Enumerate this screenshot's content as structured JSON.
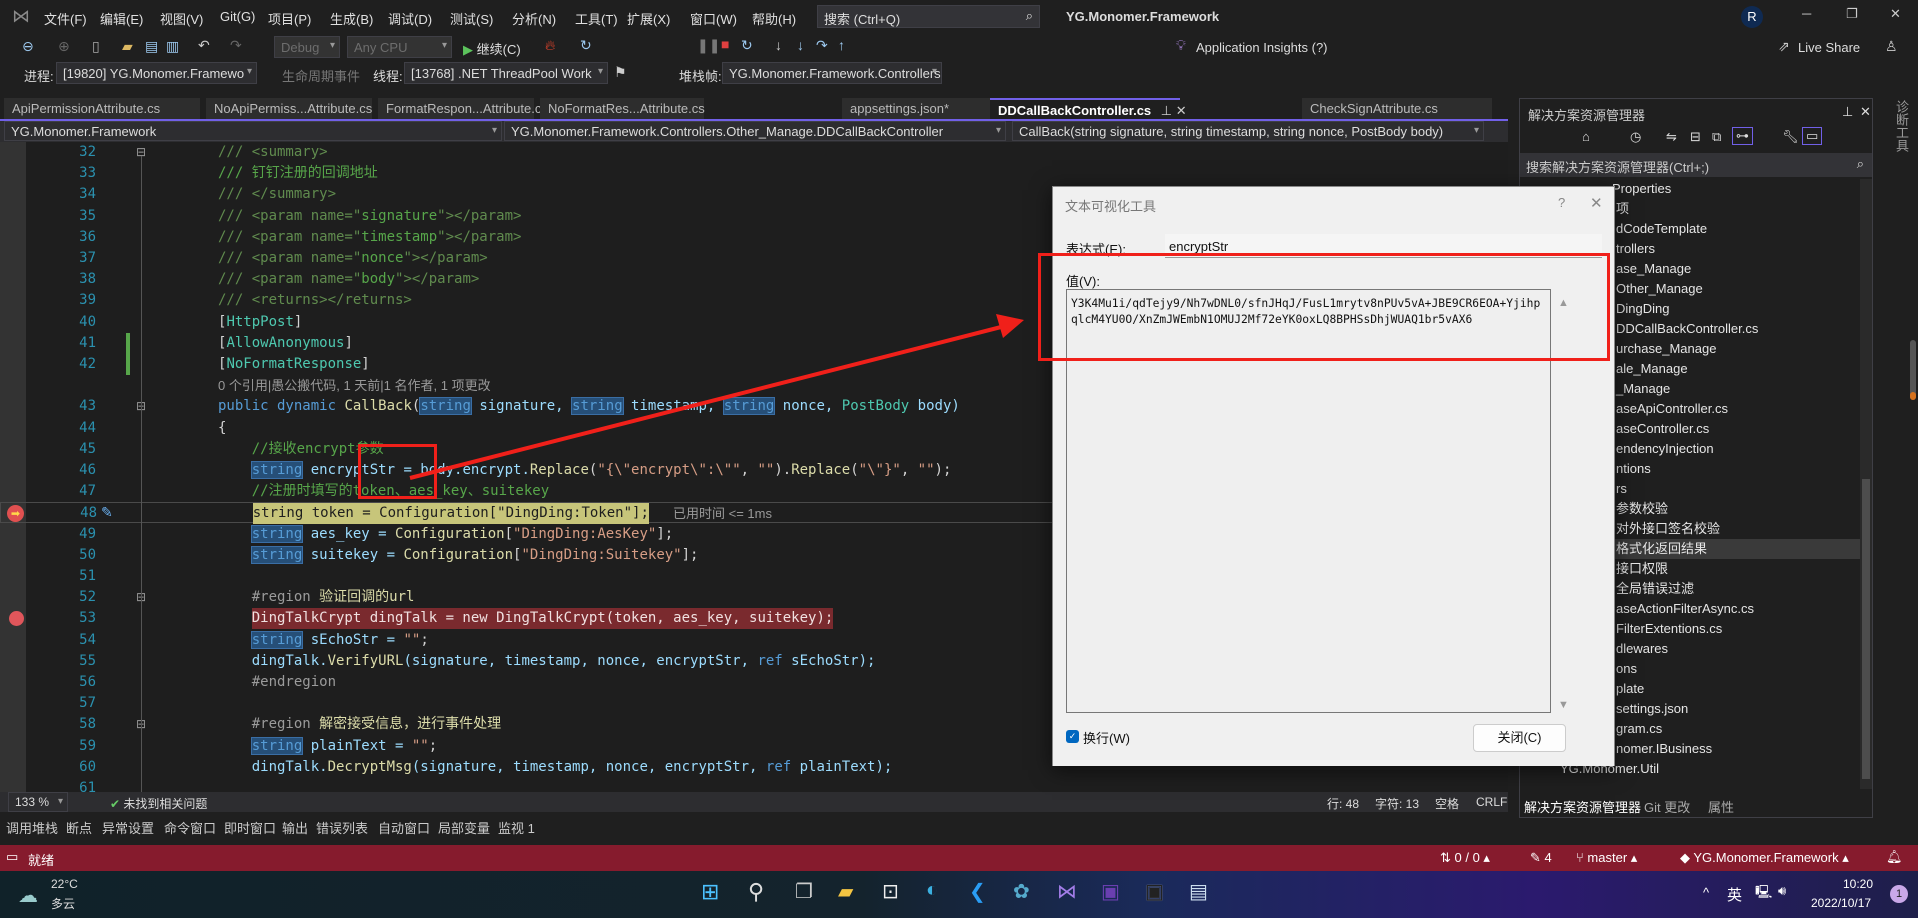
{
  "window": {
    "title": "YG.Monomer.Framework",
    "avatar": "R",
    "menu": [
      "文件(F)",
      "编辑(E)",
      "视图(V)",
      "Git(G)",
      "项目(P)",
      "生成(B)",
      "调试(D)",
      "测试(S)",
      "分析(N)",
      "工具(T)",
      "扩展(X)",
      "窗口(W)",
      "帮助(H)"
    ],
    "search_placeholder": "搜索 (Ctrl+Q)"
  },
  "toolbar": {
    "config": "Debug",
    "platform": "Any CPU",
    "continue": "继续(C)",
    "app_insights": "Application Insights (?)",
    "live_share": "Live Share"
  },
  "debug_location": {
    "process_label": "进程:",
    "process": "[19820] YG.Monomer.Framewo",
    "lifecycle": "生命周期事件",
    "thread_label": "线程:",
    "thread": "[13768] .NET ThreadPool Work",
    "stack_label": "堆栈帧:",
    "stack": "YG.Monomer.Framework.Controllers.C"
  },
  "tabs": [
    {
      "label": "ApiPermissionAttribute.cs"
    },
    {
      "label": "NoApiPermiss...Attribute.cs"
    },
    {
      "label": "FormatRespon...Attribute.cs"
    },
    {
      "label": "NoFormatRes...Attribute.cs"
    },
    {
      "label": "appsettings.json*"
    },
    {
      "label": "DDCallBackController.cs",
      "active": true
    },
    {
      "label": "CheckSignAttribute.cs"
    }
  ],
  "navbar": {
    "project": "YG.Monomer.Framework",
    "class": "YG.Monomer.Framework.Controllers.Other_Manage.DDCallBackController",
    "member": "CallBack(string signature, string timestamp, string nonce, PostBody body)"
  },
  "code": {
    "codelens": "0 个引用|愚公搬代码, 1 天前|1 名作者, 1 项更改",
    "elapsed": "已用时间 <= 1ms",
    "current_line": 48,
    "breakpoint_line": 53,
    "lines": [
      {
        "n": "32",
        "i": 0,
        "tk": [
          [
            "/// <summary>",
            "d"
          ]
        ]
      },
      {
        "n": "33",
        "i": 0,
        "tk": [
          [
            "/// 钉钉注册的回调地址",
            "c"
          ]
        ]
      },
      {
        "n": "34",
        "i": 0,
        "tk": [
          [
            "/// </summary>",
            "d"
          ]
        ]
      },
      {
        "n": "35",
        "i": 0,
        "tk": [
          [
            "/// <param name=\"",
            "d"
          ],
          [
            "signature",
            "c"
          ],
          [
            "\"></param>",
            "d"
          ]
        ]
      },
      {
        "n": "36",
        "i": 0,
        "tk": [
          [
            "/// <param name=\"",
            "d"
          ],
          [
            "timestamp",
            "c"
          ],
          [
            "\"></param>",
            "d"
          ]
        ]
      },
      {
        "n": "37",
        "i": 0,
        "tk": [
          [
            "/// <param name=\"",
            "d"
          ],
          [
            "nonce",
            "c"
          ],
          [
            "\"></param>",
            "d"
          ]
        ]
      },
      {
        "n": "38",
        "i": 0,
        "tk": [
          [
            "/// <param name=\"",
            "d"
          ],
          [
            "body",
            "c"
          ],
          [
            "\"></param>",
            "d"
          ]
        ]
      },
      {
        "n": "39",
        "i": 0,
        "tk": [
          [
            "/// <returns></returns>",
            "d"
          ]
        ]
      },
      {
        "n": "40",
        "i": 0,
        "tk": [
          [
            "[",
            "p"
          ],
          [
            "HttpPost",
            "t"
          ],
          [
            "]",
            "p"
          ]
        ]
      },
      {
        "n": "41",
        "i": 0,
        "tk": [
          [
            "[",
            "p"
          ],
          [
            "AllowAnonymous",
            "t"
          ],
          [
            "]",
            "p"
          ]
        ]
      },
      {
        "n": "42",
        "i": 0,
        "tk": [
          [
            "[",
            "p"
          ],
          [
            "NoFormatResponse",
            "t"
          ],
          [
            "]",
            "p"
          ]
        ]
      },
      {
        "n": "",
        "i": 0,
        "lens": true,
        "tk": []
      },
      {
        "n": "43",
        "i": 0,
        "tk": [
          [
            "public dynamic ",
            "k"
          ],
          [
            "CallBack",
            "m"
          ],
          [
            "(",
            "p"
          ],
          [
            "string",
            "k hl"
          ],
          [
            " signature, ",
            "v"
          ],
          [
            "string",
            "k hl"
          ],
          [
            " timestamp, ",
            "v"
          ],
          [
            "string",
            "k hl"
          ],
          [
            " nonce, ",
            "v"
          ],
          [
            "PostBody",
            "t"
          ],
          [
            " body)",
            "v"
          ]
        ]
      },
      {
        "n": "44",
        "i": 0,
        "tk": [
          [
            "{",
            "p"
          ]
        ]
      },
      {
        "n": "45",
        "i": 4,
        "tk": [
          [
            "//接收encrypt参数",
            "c"
          ]
        ]
      },
      {
        "n": "46",
        "i": 4,
        "tk": [
          [
            "string",
            "k hl"
          ],
          [
            " encryptStr = body.encrypt.",
            "v"
          ],
          [
            "Replace",
            "m"
          ],
          [
            "(",
            "p"
          ],
          [
            "\"{\\\"encrypt\\\":\\\"\"",
            "s"
          ],
          [
            ", ",
            "p"
          ],
          [
            "\"\"",
            "s"
          ],
          [
            ").",
            "p"
          ],
          [
            "Replace",
            "m"
          ],
          [
            "(",
            "p"
          ],
          [
            "\"\\\"}\"",
            "s"
          ],
          [
            ", ",
            "p"
          ],
          [
            "\"\"",
            "s"
          ],
          [
            ");",
            "p"
          ]
        ]
      },
      {
        "n": "47",
        "i": 4,
        "tk": [
          [
            "//注册时填写的token、aes_key、suitekey",
            "c"
          ]
        ]
      },
      {
        "n": "48",
        "i": 4,
        "tk": [
          [
            "string token = Configuration[\"DingDing:Token\"];",
            "p"
          ]
        ]
      },
      {
        "n": "49",
        "i": 4,
        "tk": [
          [
            "string",
            "k hl"
          ],
          [
            " aes_key = ",
            "v"
          ],
          [
            "Configuration",
            "m"
          ],
          [
            "[",
            "p"
          ],
          [
            "\"DingDing:AesKey\"",
            "s"
          ],
          [
            "];",
            "p"
          ]
        ]
      },
      {
        "n": "50",
        "i": 4,
        "tk": [
          [
            "string",
            "k hl"
          ],
          [
            " suitekey = ",
            "v"
          ],
          [
            "Configuration",
            "m"
          ],
          [
            "[",
            "p"
          ],
          [
            "\"DingDing:Suitekey\"",
            "s"
          ],
          [
            "];",
            "p"
          ]
        ]
      },
      {
        "n": "51",
        "i": 4,
        "tk": []
      },
      {
        "n": "52",
        "i": 4,
        "tk": [
          [
            "#region ",
            "r"
          ],
          [
            "验证回调的url",
            "m"
          ]
        ]
      },
      {
        "n": "53",
        "i": 4,
        "tk": [
          [
            "DingTalkCrypt dingTalk = new DingTalkCrypt(token, aes_key, suitekey);",
            "p"
          ]
        ]
      },
      {
        "n": "54",
        "i": 4,
        "tk": [
          [
            "string",
            "k hl"
          ],
          [
            " sEchoStr = ",
            "v"
          ],
          [
            "\"\"",
            "s"
          ],
          [
            ";",
            "p"
          ]
        ]
      },
      {
        "n": "55",
        "i": 4,
        "tk": [
          [
            "dingTalk.",
            "v"
          ],
          [
            "VerifyURL",
            "m"
          ],
          [
            "(signature, timestamp, nonce, encryptStr, ",
            "v"
          ],
          [
            "ref",
            "k"
          ],
          [
            " sEchoStr);",
            "v"
          ]
        ]
      },
      {
        "n": "56",
        "i": 4,
        "tk": [
          [
            "#endregion",
            "r"
          ]
        ]
      },
      {
        "n": "57",
        "i": 4,
        "tk": []
      },
      {
        "n": "58",
        "i": 4,
        "tk": [
          [
            "#region ",
            "r"
          ],
          [
            "解密接受信息，进行事件处理",
            "m"
          ]
        ]
      },
      {
        "n": "59",
        "i": 4,
        "tk": [
          [
            "string",
            "k hl"
          ],
          [
            " plainText = ",
            "v"
          ],
          [
            "\"\"",
            "s"
          ],
          [
            ";",
            "p"
          ]
        ]
      },
      {
        "n": "60",
        "i": 4,
        "tk": [
          [
            "dingTalk.",
            "v"
          ],
          [
            "DecryptMsg",
            "m"
          ],
          [
            "(signature, timestamp, nonce, encryptStr, ",
            "v"
          ],
          [
            "ref",
            "k"
          ],
          [
            " plainText);",
            "v"
          ]
        ]
      },
      {
        "n": "61",
        "i": 4,
        "tk": []
      }
    ]
  },
  "editor_status": {
    "zoom": "133 %",
    "issues": "未找到相关问题",
    "line": "行: 48",
    "char": "字符: 13",
    "whitespace": "空格",
    "eol": "CRLF"
  },
  "tool_tabs": [
    "调用堆栈",
    "断点",
    "异常设置",
    "命令窗口",
    "即时窗口",
    "输出",
    "错误列表",
    "自动窗口",
    "局部变量",
    "监视 1"
  ],
  "solution_explorer": {
    "title": "解决方案资源管理器",
    "search_placeholder": "搜索解决方案资源管理器(Ctrl+;)",
    "items": [
      "Properties",
      "项",
      "dCodeTemplate",
      "trollers",
      "ase_Manage",
      "Other_Manage",
      "DingDing",
      "DDCallBackController.cs",
      "urchase_Manage",
      "ale_Manage",
      "_Manage",
      "aseApiController.cs",
      "aseController.cs",
      "endencyInjection",
      "ntions",
      "rs",
      "参数校验",
      "对外接口签名校验",
      "格式化返回结果",
      "接口权限",
      "全局错误过滤",
      "aseActionFilterAsync.cs",
      "FilterExtentions.cs",
      "dlewares",
      "ons",
      "plate",
      "settings.json",
      "gram.cs",
      "nomer.IBusiness",
      "YG.Monomer.Util"
    ],
    "selected_index": 18,
    "bottom_tabs": [
      "解决方案资源管理器",
      "Git 更改",
      "属性"
    ],
    "side_label": "诊断工具"
  },
  "dialog": {
    "title": "文本可视化工具",
    "expression_label": "表达式(E):",
    "expression": "encryptStr",
    "value_label": "值(V):",
    "value": "Y3K4Mu1i/qdTejy9/Nh7wDNL0/sfnJHqJ/FusL1mrytv8nPUv5vA+JBE9CR6EOA+YjihpqlcM4YU0O/XnZmJWEmbN1OMUJ2Mf72eYK0oxLQ8BPHSsDhjWUAQ1br5vAX6",
    "wrap_label": "换行(W)",
    "wrap_checked": true,
    "close_button": "关闭(C)"
  },
  "statusbar": {
    "ready": "就绪",
    "sync": "0 / 0",
    "changes": "4",
    "branch": "master",
    "repo": "YG.Monomer.Framework",
    "color": "#861b2d"
  },
  "taskbar": {
    "temperature": "22°C",
    "weather": "多云",
    "ime": "英",
    "time": "10:20",
    "date": "2022/10/17",
    "notifications": "1"
  },
  "annotation_color": "#f0201a"
}
